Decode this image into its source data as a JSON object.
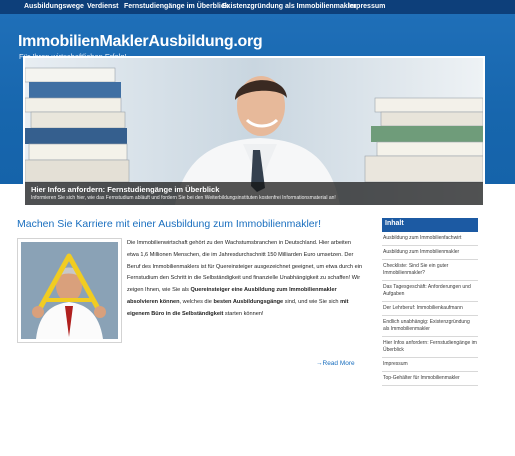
{
  "topnav": {
    "items": [
      "Ausbildungswege",
      "Verdienst",
      "Fernstudiengänge im Überblick",
      "Existenzgründung als Immobilienmakler",
      "Impressum"
    ]
  },
  "header": {
    "title": "ImmobilienMaklerAusbildung.org",
    "subtitle": "Für Ihren wirtschaftlichen Erfolg!"
  },
  "hero": {
    "caption_title": "Hier Infos anfordern: Fernstudiengänge im Überblick",
    "caption_text": "Informieren Sie sich hier, wie das Fernstudium abläuft und fordern Sie bei den Weiterbildungsinstituten kostenfrei Informationsmaterial an!"
  },
  "main": {
    "heading": "Machen Sie Karriere mit einer Ausbildung zum Immobilienmakler!",
    "p1": "Die Immobilienwirtschaft gehört zu den Wachstumsbranchen in Deutschland. Hier arbeiten etwa 1,6 Millionen Menschen, die im Jahresdurchschnitt 150 Milliarden Euro umsetzen. Der Beruf des Immobilienmaklers ist für Quereinsteiger ausgezeichnet geeignet, um etwa durch ein Fernstudium den Schritt in die Selbständigkeit und finanzielle Unabhängigkeit zu schaffen! Wir zeigen Ihnen, wie Sie als ",
    "b1": "Quereinsteiger eine Ausbildung zum Immobilienmakler absolvieren können",
    "p2": ", welches die ",
    "b2": "besten Ausbildungsgänge",
    "p3": " sind, und wie Sie sich ",
    "b3": "mit eigenem Büro in die Selbständigkeit",
    "p4": " starten können!",
    "read_more": "→Read More"
  },
  "sidebar": {
    "heading": "Inhalt",
    "items": [
      "Ausbildung zum Immobilienfachwirt",
      "Ausbildung zum Immobilienmakler",
      "Checkliste: Sind Sie ein guter Immobilienmakler?",
      "Das Tagesgeschäft: Anforderungen und Aufgaben",
      "Der Lehrberuf: Immobilienkaufmann",
      "Endlich unabhängig: Existenzgründung als Immobilienmakler",
      "Hier Infos anfordern: Fernstudiengänge im Überblick",
      "Impressum",
      "Top-Gehälter für Immobilienmakler"
    ]
  },
  "colors": {
    "nav_bg": "#0d3f7a",
    "header_blue": "#1766ad",
    "link_blue": "#1a6fbf",
    "sidebar_heading_bg": "#1c5aa3"
  }
}
